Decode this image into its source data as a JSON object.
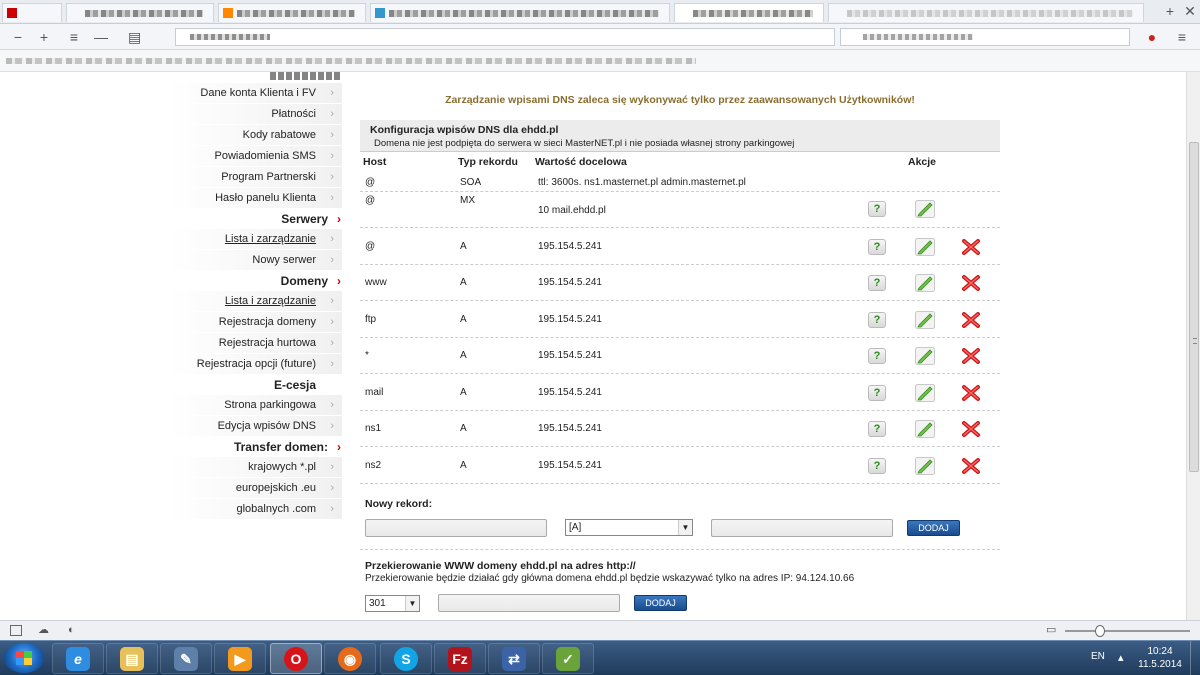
{
  "sidebar": {
    "items": [
      {
        "type": "item",
        "label": "Dane konta Klienta i FV",
        "link": false
      },
      {
        "type": "item",
        "label": "Płatności",
        "link": false
      },
      {
        "type": "item",
        "label": "Kody rabatowe",
        "link": false
      },
      {
        "type": "item",
        "label": "Powiadomienia SMS",
        "link": false
      },
      {
        "type": "item",
        "label": "Program Partnerski",
        "link": false
      },
      {
        "type": "item",
        "label": "Hasło panelu Klienta",
        "link": false
      },
      {
        "type": "head",
        "label": "Serwery"
      },
      {
        "type": "item",
        "label": "Lista i zarządzanie",
        "link": true
      },
      {
        "type": "item",
        "label": "Nowy serwer",
        "link": false
      },
      {
        "type": "head",
        "label": "Domeny"
      },
      {
        "type": "item",
        "label": "Lista i zarządzanie",
        "link": true
      },
      {
        "type": "item",
        "label": "Rejestracja domeny",
        "link": false
      },
      {
        "type": "item",
        "label": "Rejestracja hurtowa",
        "link": false
      },
      {
        "type": "item",
        "label": "Rejestracja opcji (future)",
        "link": false
      },
      {
        "type": "headplain",
        "label": "E-cesja"
      },
      {
        "type": "item",
        "label": "Strona parkingowa",
        "link": false
      },
      {
        "type": "item",
        "label": "Edycja wpisów DNS",
        "link": false
      },
      {
        "type": "head",
        "label": "Transfer domen:"
      },
      {
        "type": "item",
        "label": "krajowych *.pl",
        "link": false
      },
      {
        "type": "item",
        "label": "europejskich .eu",
        "link": false
      },
      {
        "type": "item",
        "label": "globalnych .com",
        "link": false
      }
    ]
  },
  "main": {
    "warning": "Zarządzanie wpisami DNS zaleca się wykonywać tylko przez zaawansowanych Użytkowników!",
    "box_title": "Konfiguracja wpisów DNS dla ehdd.pl",
    "box_subtitle": "Domena nie jest podpięta do serwera w sieci MasterNET.pl i nie posiada własnej strony parkingowej",
    "columns": {
      "host": "Host",
      "type": "Typ rekordu",
      "value": "Wartość docelowa",
      "actions": "Akcje"
    },
    "records": [
      {
        "host": "@",
        "type": "SOA",
        "value": "ttl: 3600s. ns1.masternet.pl admin.masternet.pl",
        "actions": "none"
      },
      {
        "host": "@",
        "type": "MX",
        "value": "10  mail.ehdd.pl",
        "actions": "help-edit"
      },
      {
        "host": "@",
        "type": "A",
        "value": "195.154.5.241",
        "actions": "all"
      },
      {
        "host": "www",
        "type": "A",
        "value": "195.154.5.241",
        "actions": "all"
      },
      {
        "host": "ftp",
        "type": "A",
        "value": "195.154.5.241",
        "actions": "all"
      },
      {
        "host": "*",
        "type": "A",
        "value": "195.154.5.241",
        "actions": "all"
      },
      {
        "host": "mail",
        "type": "A",
        "value": "195.154.5.241",
        "actions": "all"
      },
      {
        "host": "ns1",
        "type": "A",
        "value": "195.154.5.241",
        "actions": "all"
      },
      {
        "host": "ns2",
        "type": "A",
        "value": "195.154.5.241",
        "actions": "all"
      }
    ],
    "help_glyph": "?",
    "new_record_label": "Nowy rekord:",
    "new_record_type": "[A]",
    "add_label": "DODAJ",
    "redirect_title": "Przekierowanie WWW domeny ehdd.pl na adres http://",
    "redirect_desc": "Przekierowanie będzie działać gdy główna domena ehdd.pl będzie wskazywać tylko na adres IP: 94.124.10.66",
    "redirect_code": "301",
    "redirect_add_label": "DODAJ"
  },
  "taskbar": {
    "lang": "EN",
    "time": "10:24",
    "date": "11.5.2014"
  },
  "colors": {
    "warning": "#8a6d2f",
    "help": "#2a8a1a",
    "delete": "#cc1a1a",
    "button_blue": "#1a4c8c",
    "sidebar_arrow": "#cc0000"
  }
}
